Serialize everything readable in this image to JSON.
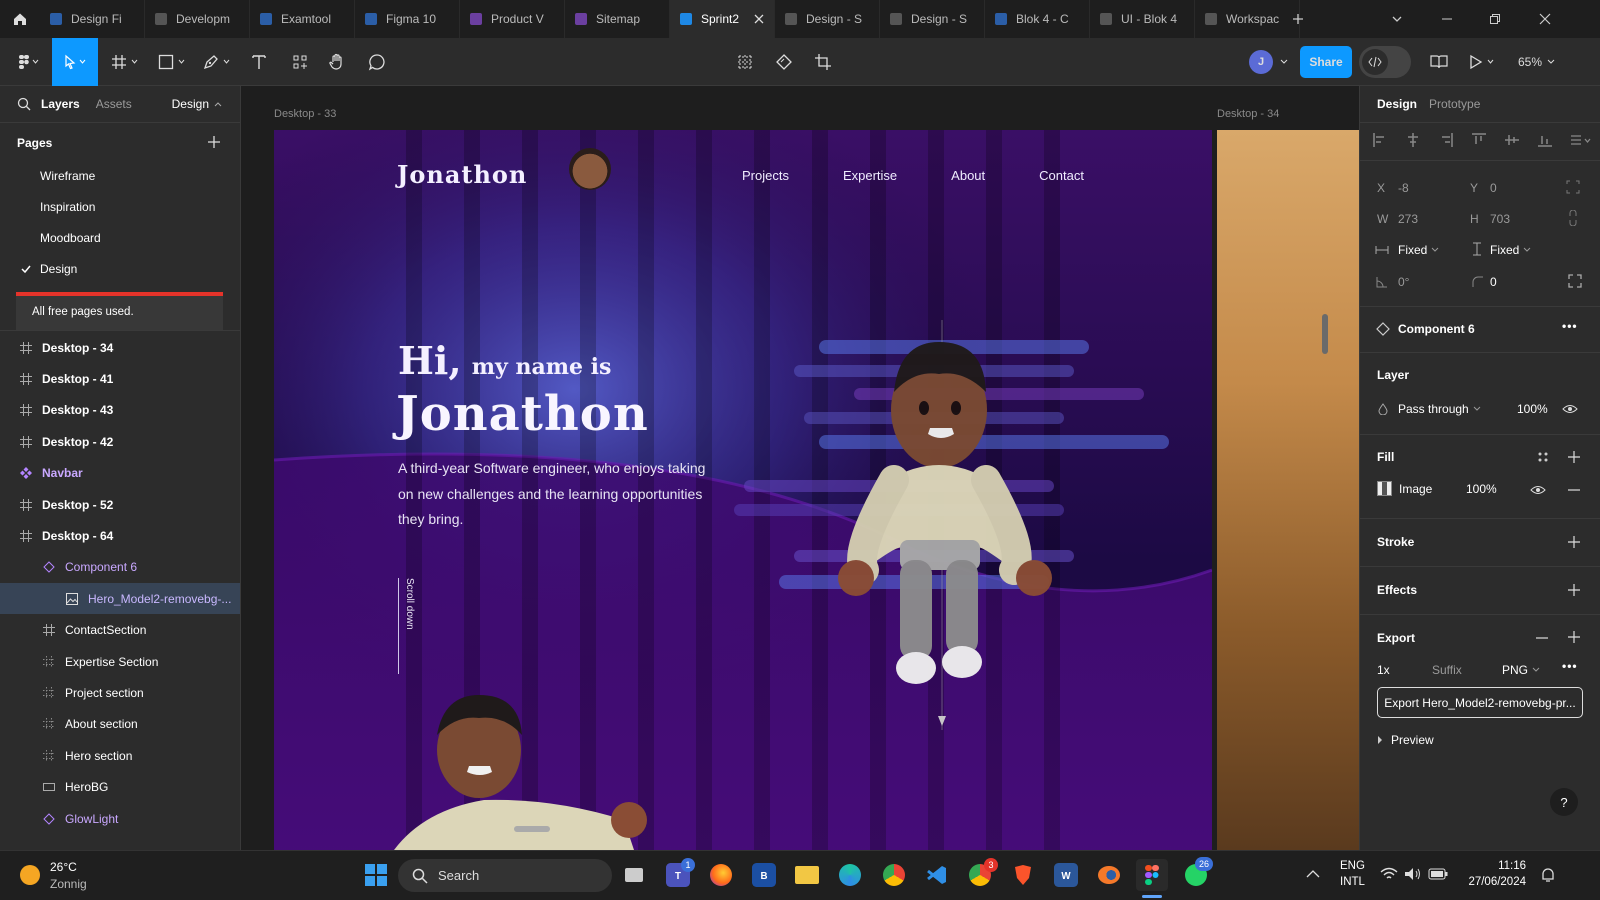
{
  "tabs": [
    {
      "label": "Design Fi",
      "color": "#2b5ea7"
    },
    {
      "label": "Developm",
      "color": "#555"
    },
    {
      "label": "Examtool",
      "color": "#2b5ea7"
    },
    {
      "label": "Figma 10",
      "color": "#2b5ea7"
    },
    {
      "label": "Product V",
      "color": "#6b3fa0"
    },
    {
      "label": "Sitemap",
      "color": "#6b3fa0"
    },
    {
      "label": "Sprint2",
      "color": "#1e88e5",
      "active": true
    },
    {
      "label": "Design - S",
      "color": "#555"
    },
    {
      "label": "Design - S",
      "color": "#555"
    },
    {
      "label": "Blok 4 - C",
      "color": "#2b5ea7"
    },
    {
      "label": "UI - Blok 4",
      "color": "#555"
    },
    {
      "label": "Workspac",
      "color": "#555"
    }
  ],
  "toolbar": {
    "avatar": "J",
    "share": "Share",
    "zoom": "65%"
  },
  "left": {
    "tab_layers": "Layers",
    "tab_assets": "Assets",
    "design_toggle": "Design",
    "pages_title": "Pages",
    "pages": [
      "Wireframe",
      "Inspiration",
      "Moodboard",
      "Design"
    ],
    "free_pages": "All free pages used.",
    "layers": [
      {
        "label": "Desktop - 34",
        "icon": "frame",
        "indent": 0,
        "bold": true
      },
      {
        "label": "Desktop - 41",
        "icon": "frame",
        "indent": 0,
        "bold": true
      },
      {
        "label": "Desktop - 43",
        "icon": "frame",
        "indent": 0,
        "bold": true
      },
      {
        "label": "Desktop - 42",
        "icon": "frame",
        "indent": 0,
        "bold": true
      },
      {
        "label": "Navbar",
        "icon": "component",
        "indent": 0,
        "bold": true,
        "purple": true
      },
      {
        "label": "Desktop - 52",
        "icon": "frame",
        "indent": 0,
        "bold": true
      },
      {
        "label": "Desktop - 64",
        "icon": "frame",
        "indent": 0,
        "bold": true
      },
      {
        "label": "Component 6",
        "icon": "instance",
        "indent": 1,
        "purple": true
      },
      {
        "label": "Hero_Model2-removebg-...",
        "icon": "image",
        "indent": 2,
        "selected": true
      },
      {
        "label": "ContactSection",
        "icon": "frame",
        "indent": 1
      },
      {
        "label": "Expertise Section",
        "icon": "section",
        "indent": 1
      },
      {
        "label": "Project section",
        "icon": "section",
        "indent": 1
      },
      {
        "label": "About section",
        "icon": "section",
        "indent": 1
      },
      {
        "label": "Hero section",
        "icon": "section",
        "indent": 1
      },
      {
        "label": "HeroBG",
        "icon": "rect",
        "indent": 1
      },
      {
        "label": "GlowLight",
        "icon": "instance",
        "indent": 1,
        "purple": true
      }
    ]
  },
  "canvas": {
    "frame1_label": "Desktop - 33",
    "frame2_label": "Desktop - 34",
    "logo": "Jonathon",
    "nav": [
      "Projects",
      "Expertise",
      "About",
      "Contact"
    ],
    "hi": "Hi,",
    "my_name_is": "my name is",
    "name": "Jonathon",
    "tagline": [
      "A third-year Software engineer, who enjoys taking",
      "on new challenges and the learning opportunities",
      "they bring."
    ],
    "scroll": "Scroll down"
  },
  "right": {
    "tab_design": "Design",
    "tab_prototype": "Prototype",
    "x_label": "X",
    "x": "-8",
    "y_label": "Y",
    "y": "0",
    "w_label": "W",
    "w": "273",
    "h_label": "H",
    "h": "703",
    "hfix": "Fixed",
    "vfix": "Fixed",
    "rotation": "0°",
    "radius": "0",
    "component": "Component 6",
    "layer_title": "Layer",
    "blend": "Pass through",
    "layer_opacity": "100%",
    "fill_title": "Fill",
    "fill_type": "Image",
    "fill_opacity": "100%",
    "stroke_title": "Stroke",
    "effects_title": "Effects",
    "export_title": "Export",
    "export_scale": "1x",
    "export_suffix": "Suffix",
    "export_format": "PNG",
    "export_button": "Export Hero_Model2-removebg-pr...",
    "preview": "Preview",
    "help": "?"
  },
  "taskbar": {
    "temp": "26°C",
    "weather": "Zonnig",
    "search": "Search",
    "lang1": "ENG",
    "lang2": "INTL",
    "time": "11:16",
    "date": "27/06/2024",
    "badge_teams": "1",
    "badge_chrome": "3",
    "badge_whatsapp": "26"
  },
  "colors": {
    "accent": "#0d99ff",
    "purple": "#b384ff",
    "red": "#e5332a"
  }
}
